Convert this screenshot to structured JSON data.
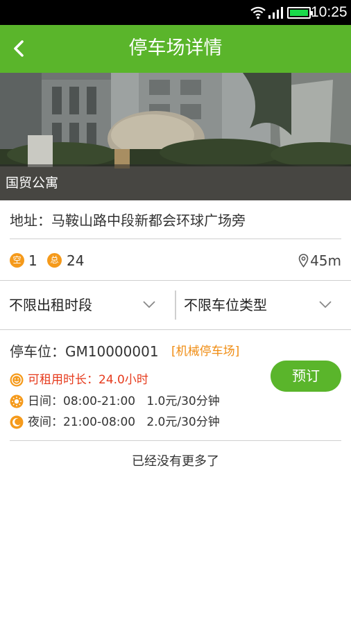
{
  "status_bar": {
    "time": "10:25"
  },
  "header": {
    "title": "停车场详情",
    "back_icon": "chevron-left-icon"
  },
  "hero": {
    "caption": "国贸公寓"
  },
  "address": {
    "text": "地址：马鞍山路中段新都会环球广场旁"
  },
  "counts": {
    "empty_badge": "空",
    "empty_value": "1",
    "total_badge": "总",
    "total_value": "24",
    "distance": "45m"
  },
  "filters": {
    "time_filter": "不限出租时段",
    "type_filter": "不限车位类型"
  },
  "slot": {
    "title": "停车位：GM10000001",
    "tag": "[机械停车场]",
    "duration": "可租用时长：24.0小时",
    "day": "日间：08:00-21:00   1.0元/30分钟",
    "night": "夜间：21:00-08:00   2.0元/30分钟",
    "book_label": "预订"
  },
  "footer": {
    "no_more": "已经没有更多了"
  },
  "colors": {
    "brand_green": "#5ab52b",
    "accent_orange": "#f59a1b",
    "alert_red": "#e63a1c"
  }
}
